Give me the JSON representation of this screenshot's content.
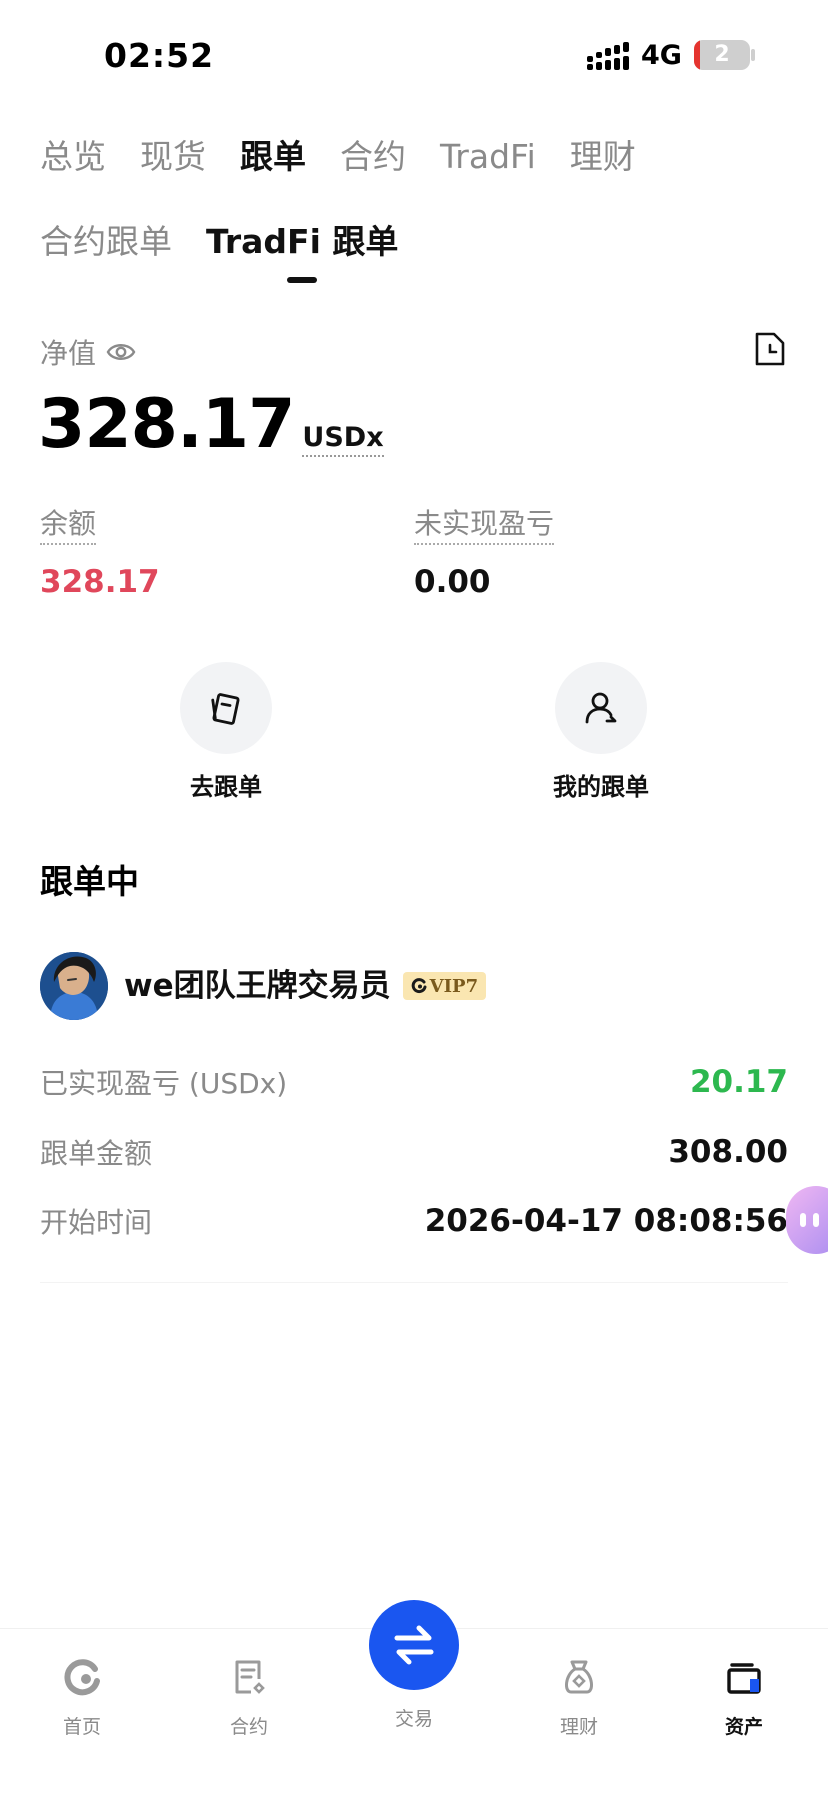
{
  "status_bar": {
    "time": "02:52",
    "network": "4G",
    "battery": "2"
  },
  "main_tabs": [
    {
      "label": "总览",
      "active": false
    },
    {
      "label": "现货",
      "active": false
    },
    {
      "label": "跟单",
      "active": true
    },
    {
      "label": "合约",
      "active": false
    },
    {
      "label": "TradFi",
      "active": false
    },
    {
      "label": "理财",
      "active": false
    }
  ],
  "sub_tabs": [
    {
      "label": "合约跟单",
      "active": false
    },
    {
      "label": "TradFi 跟单",
      "active": true
    }
  ],
  "net_value": {
    "label": "净值",
    "amount": "328.17",
    "unit": "USDx"
  },
  "stats": {
    "balance": {
      "label": "余额",
      "value": "328.17"
    },
    "unrealized": {
      "label": "未实现盈亏",
      "value": "0.00"
    }
  },
  "actions": {
    "go_copy": "去跟单",
    "my_copy": "我的跟单"
  },
  "section": {
    "title": "跟单中",
    "trader": {
      "name": "we团队王牌交易员",
      "vip": "VIP7",
      "realized_label": "已实现盈亏 (USDx)",
      "realized_value": "20.17",
      "amount_label": "跟单金额",
      "amount_value": "308.00",
      "start_label": "开始时间",
      "start_value": "2026-04-17 08:08:56"
    }
  },
  "bottom_nav": {
    "home": "首页",
    "contract": "合约",
    "trade": "交易",
    "earn": "理财",
    "assets": "资产"
  },
  "colors": {
    "accent": "#1a56f0",
    "red": "#e0475b",
    "green": "#2db84f"
  }
}
